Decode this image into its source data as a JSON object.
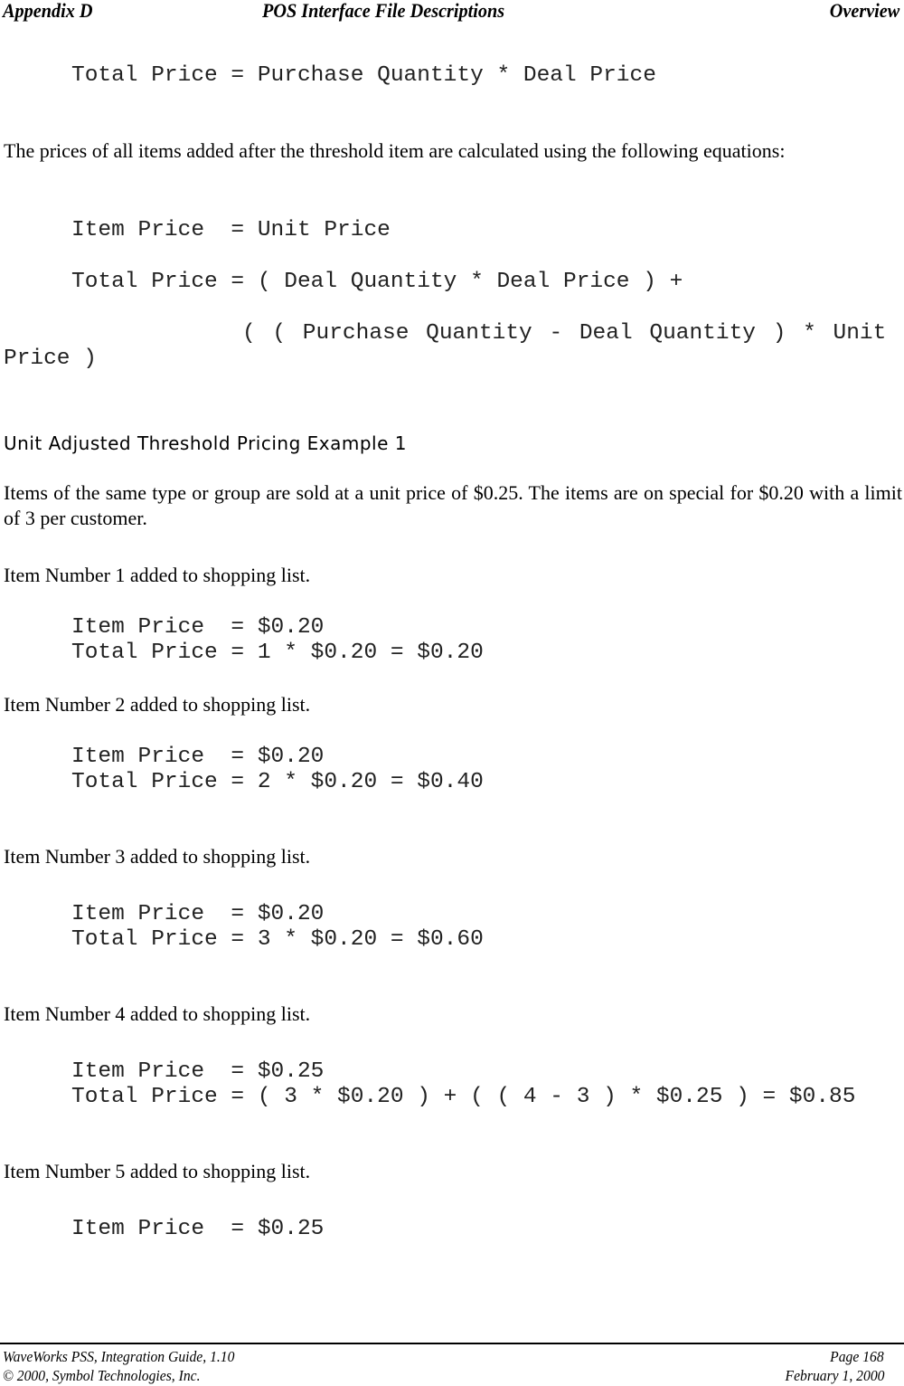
{
  "header": {
    "left": "Appendix D",
    "center": "POS Interface File Descriptions",
    "right": "Overview"
  },
  "content": {
    "deal_total_formula": "Total Price = Purchase Quantity * Deal Price",
    "after_threshold_text": "The prices of all items added after the threshold item are calculated using the following equations:",
    "after_threshold_item_price": "Item Price  = Unit Price",
    "after_threshold_total_line1": "Total Price = ( Deal Quantity * Deal Price ) +",
    "after_threshold_total_line2": "( ( Purchase Quantity - Deal Quantity ) * Unit",
    "after_threshold_total_line3": "Price )",
    "example_heading": "Unit Adjusted Threshold Pricing Example 1",
    "example_intro": "Items of the same type or group are sold at a unit price of $0.25.  The items are on special for $0.20 with a limit of 3 per customer.",
    "items": [
      {
        "label": "Item Number 1 added to shopping list.",
        "item_price": "Item Price  = $0.20",
        "total_price": "Total Price = 1 * $0.20 = $0.20"
      },
      {
        "label": "Item Number 2 added to shopping list.",
        "item_price": "Item Price  = $0.20",
        "total_price": "Total Price = 2 * $0.20 = $0.40"
      },
      {
        "label": "Item Number 3 added to shopping list.",
        "item_price": "Item Price  = $0.20",
        "total_price": "Total Price = 3 * $0.20 = $0.60"
      },
      {
        "label": "Item Number 4 added to shopping list.",
        "item_price": "Item Price  = $0.25",
        "total_price": "Total Price = ( 3 * $0.20 ) + ( ( 4 - 3 ) * $0.25 ) = $0.85"
      },
      {
        "label": "Item Number 5 added to shopping list.",
        "item_price": "Item Price  = $0.25"
      }
    ]
  },
  "footer": {
    "left_line1": "WaveWorks PSS, Integration Guide, 1.10",
    "left_line2": "© 2000, Symbol Technologies, Inc.",
    "right_line1": "Page 168",
    "right_line2": "February 1, 2000"
  }
}
